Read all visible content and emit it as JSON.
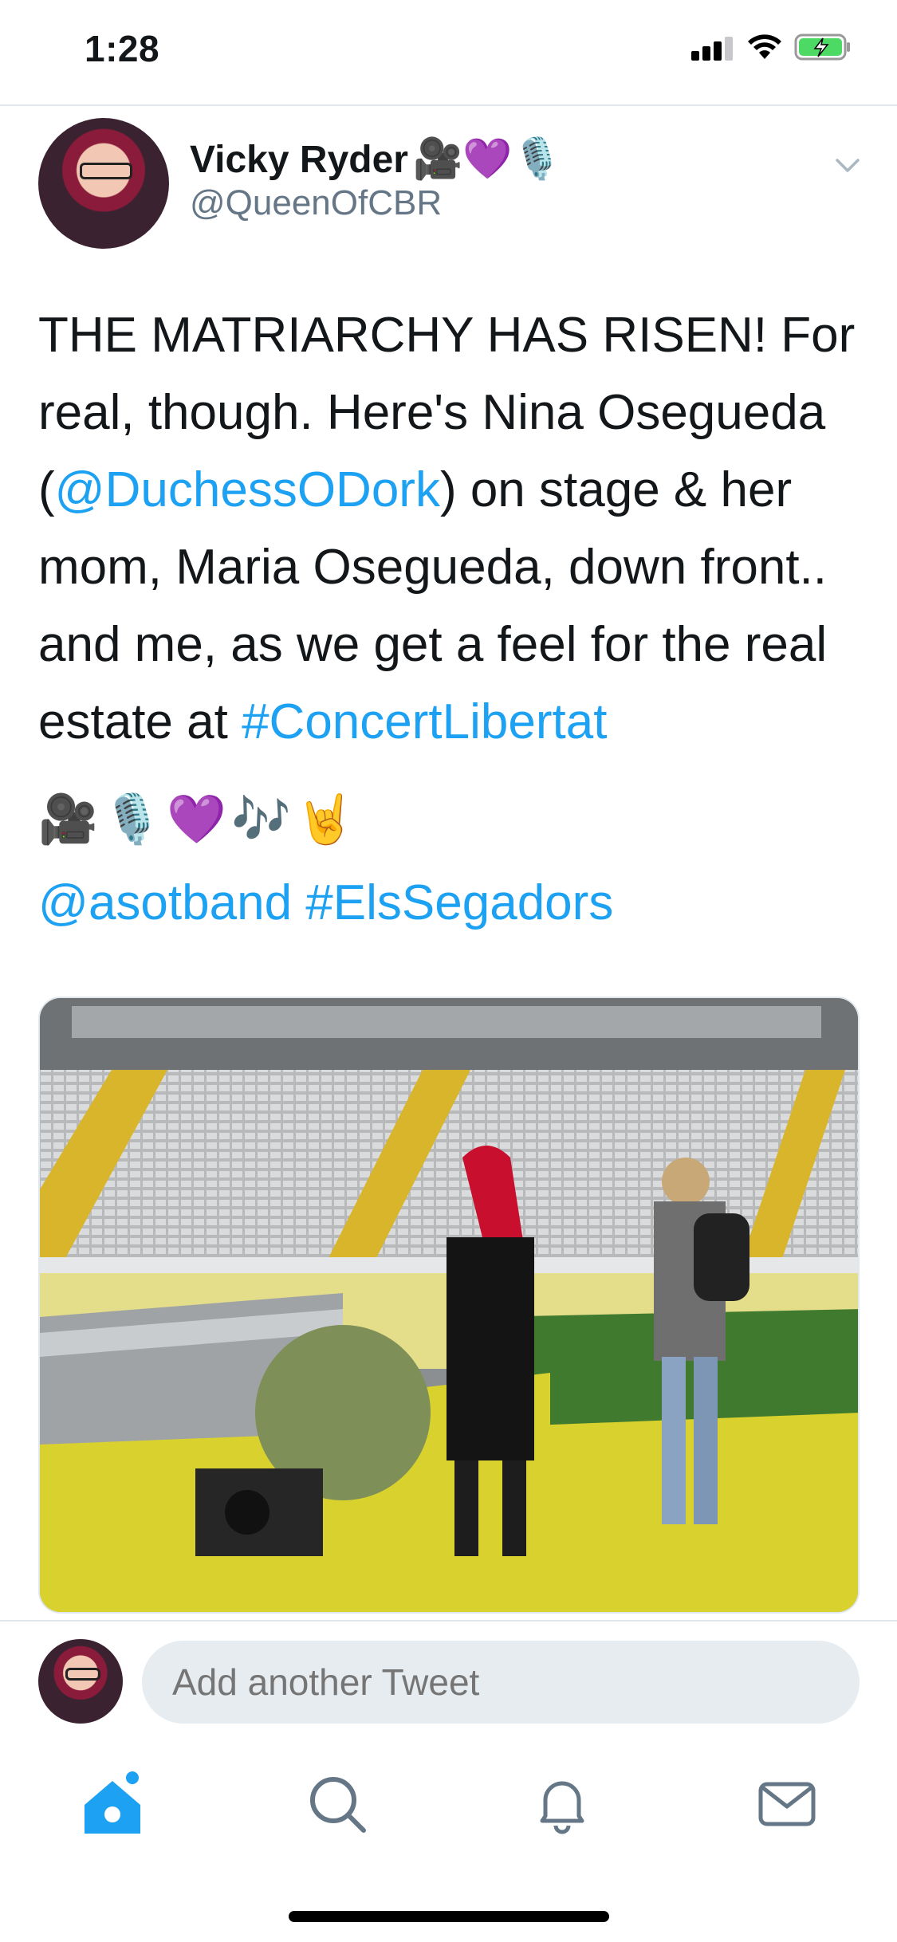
{
  "status_bar": {
    "time": "1:28"
  },
  "tweet": {
    "author": {
      "name": "Vicky Ryder",
      "name_emoji": "🎥💜🎙️",
      "handle": "@QueenOfCBR"
    },
    "text": {
      "p1": "THE MATRIARCHY HAS RISEN! For real, though. Here's Nina Osegueda (",
      "mention": "@DuchessODork",
      "p2": ") on stage & her mom, Maria Osegueda, down front.. and me, as we get a feel for the real estate at ",
      "hashtag1": "#ConcertLibertat",
      "emojis": "🎥🎙️💜🎶🤘",
      "mention2": "@asotband",
      "hashtag2": "#ElsSegadors"
    },
    "media_icon": "photo-of-stadium-stage"
  },
  "reply": {
    "placeholder": "Add another Tweet"
  },
  "tabbar": {
    "items": [
      {
        "name": "home-icon",
        "active": true
      },
      {
        "name": "search-icon",
        "active": false
      },
      {
        "name": "notifications-icon",
        "active": false
      },
      {
        "name": "messages-icon",
        "active": false
      }
    ]
  },
  "colors": {
    "accent": "#1da1f2",
    "text": "#14171a",
    "secondary": "#657786",
    "input_bg": "#e6ecf0"
  }
}
